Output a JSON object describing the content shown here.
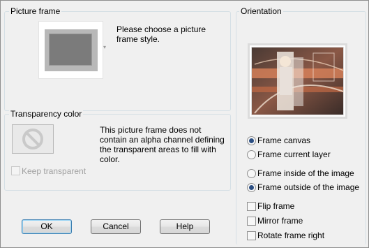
{
  "picture_frame": {
    "title": "Picture frame",
    "message": "Please choose a picture frame style."
  },
  "transparency": {
    "title": "Transparency color",
    "message": "This picture frame does not contain an alpha channel defining the transparent areas to fill with color.",
    "keep_transparent_label": "Keep transparent",
    "swatch_icon": "no-symbol-icon"
  },
  "orientation": {
    "title": "Orientation",
    "radio_frame_canvas": "Frame canvas",
    "radio_frame_current_layer": "Frame current layer",
    "radio_frame_inside": "Frame inside of the image",
    "radio_frame_outside": "Frame outside of the image",
    "check_flip": "Flip frame",
    "check_mirror": "Mirror frame",
    "check_rotate": "Rotate frame right",
    "selected_target": "Frame canvas",
    "selected_placement": "Frame outside of the image"
  },
  "buttons": {
    "ok": "OK",
    "cancel": "Cancel",
    "help": "Help"
  },
  "colors": {
    "dialog_bg": "#f0f0f0",
    "radio_dot": "#2b4e82",
    "default_button_border": "#3c7fb1"
  }
}
